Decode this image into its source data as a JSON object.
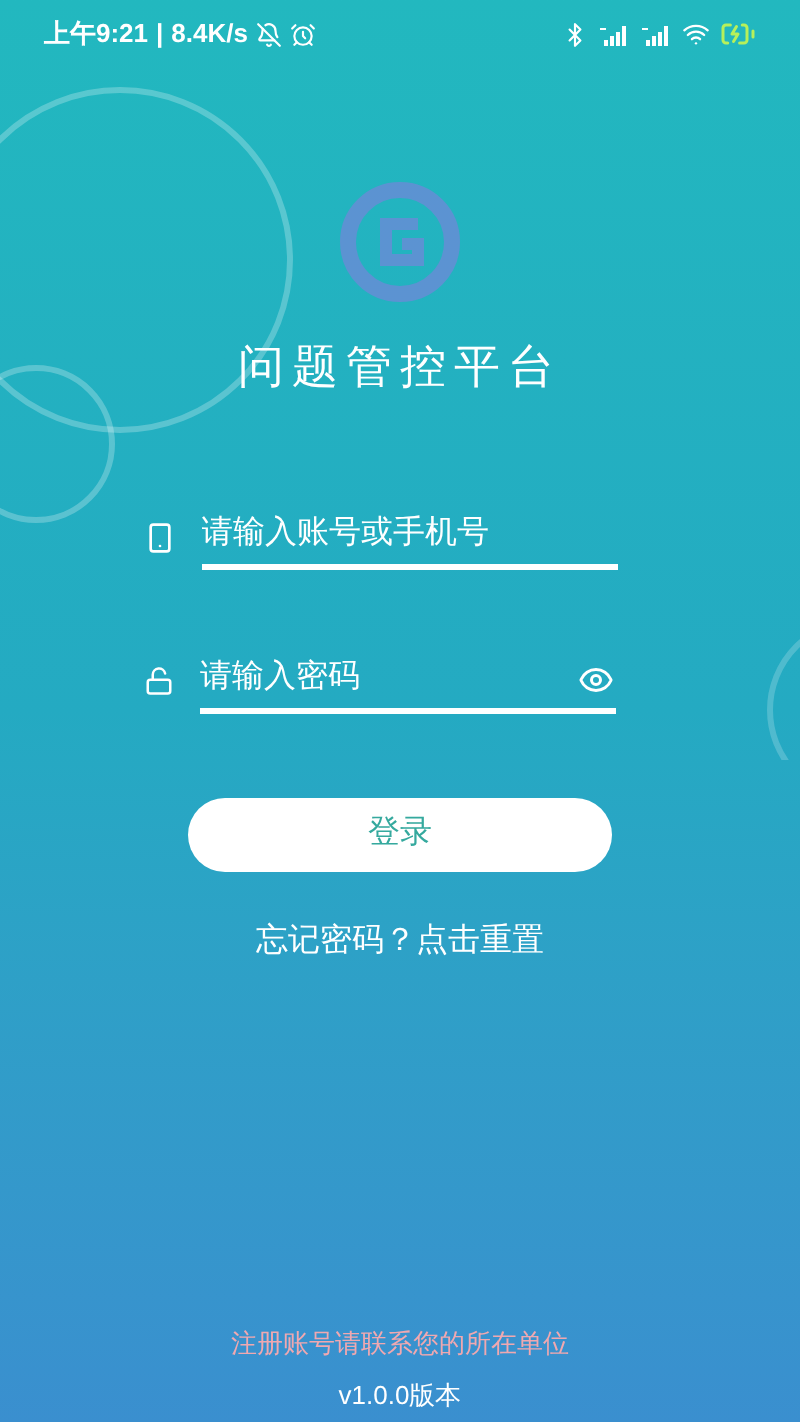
{
  "status_bar": {
    "time": "上午9:21",
    "separator": "|",
    "speed": "8.4K/s"
  },
  "title": "问题管控平台",
  "account_field": {
    "placeholder": "请输入账号或手机号"
  },
  "password_field": {
    "placeholder": "请输入密码"
  },
  "login_button": "登录",
  "forgot_link": "忘记密码？点击重置",
  "register_note": "注册账号请联系您的所在单位",
  "version": "v1.0.0版本"
}
